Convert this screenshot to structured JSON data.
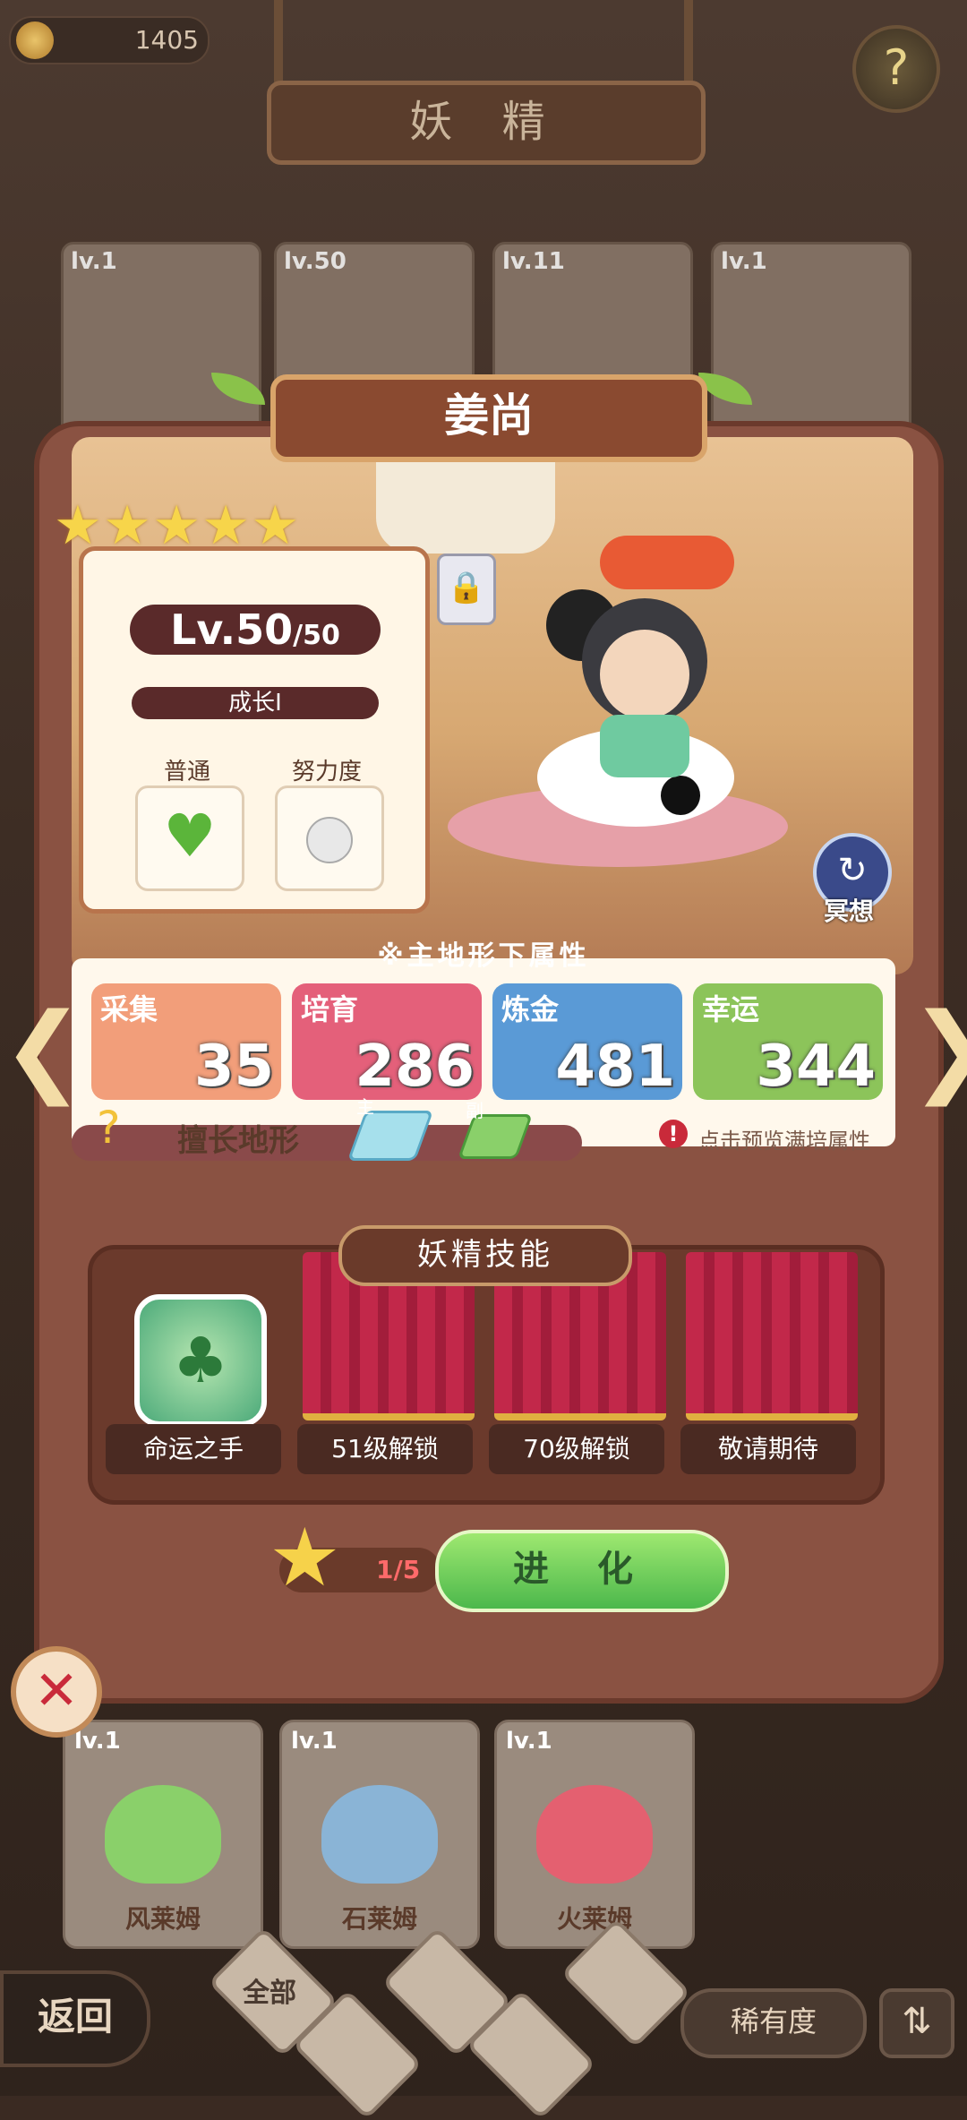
{
  "currency": {
    "amount": "1405"
  },
  "header": {
    "title": "妖 精"
  },
  "top_cards": [
    {
      "level": "lv.1"
    },
    {
      "level": "lv.50"
    },
    {
      "level": "lv.11"
    },
    {
      "level": "lv.1"
    }
  ],
  "fairy": {
    "name": "姜尚",
    "stars": 5,
    "level": "Lv.50",
    "level_max": "/50",
    "growth": "成长I",
    "type_label": "普通",
    "effort_label": "努力度",
    "meditate_label": "冥想"
  },
  "attributes": {
    "title": "※主地形下属性",
    "items": [
      {
        "label": "采集",
        "value": "35",
        "color": "#f29e7a"
      },
      {
        "label": "培育",
        "value": "286",
        "color": "#e4607a"
      },
      {
        "label": "炼金",
        "value": "481",
        "color": "#5a9ad6"
      },
      {
        "label": "幸运",
        "value": "344",
        "color": "#8cc45a"
      }
    ],
    "terrain_label": "擅长地形",
    "main_tag": "主",
    "sub_tag": "副",
    "preview_text": "点击预览满培属性"
  },
  "skills": {
    "title": "妖精技能",
    "items": [
      {
        "label": "命运之手"
      },
      {
        "label": "51级解锁"
      },
      {
        "label": "70级解锁"
      },
      {
        "label": "敬请期待"
      }
    ]
  },
  "evolve": {
    "progress": "1/5",
    "button": "进 化"
  },
  "bottom_cards": [
    {
      "level": "lv.1",
      "name": "风莱姆",
      "color": "#8ad06a"
    },
    {
      "level": "lv.1",
      "name": "石莱姆",
      "color": "#8ab4d6"
    },
    {
      "level": "lv.1",
      "name": "火莱姆",
      "color": "#e46070"
    }
  ],
  "nav": {
    "back": "返回",
    "filter_all": "全部",
    "rarity": "稀有度"
  }
}
